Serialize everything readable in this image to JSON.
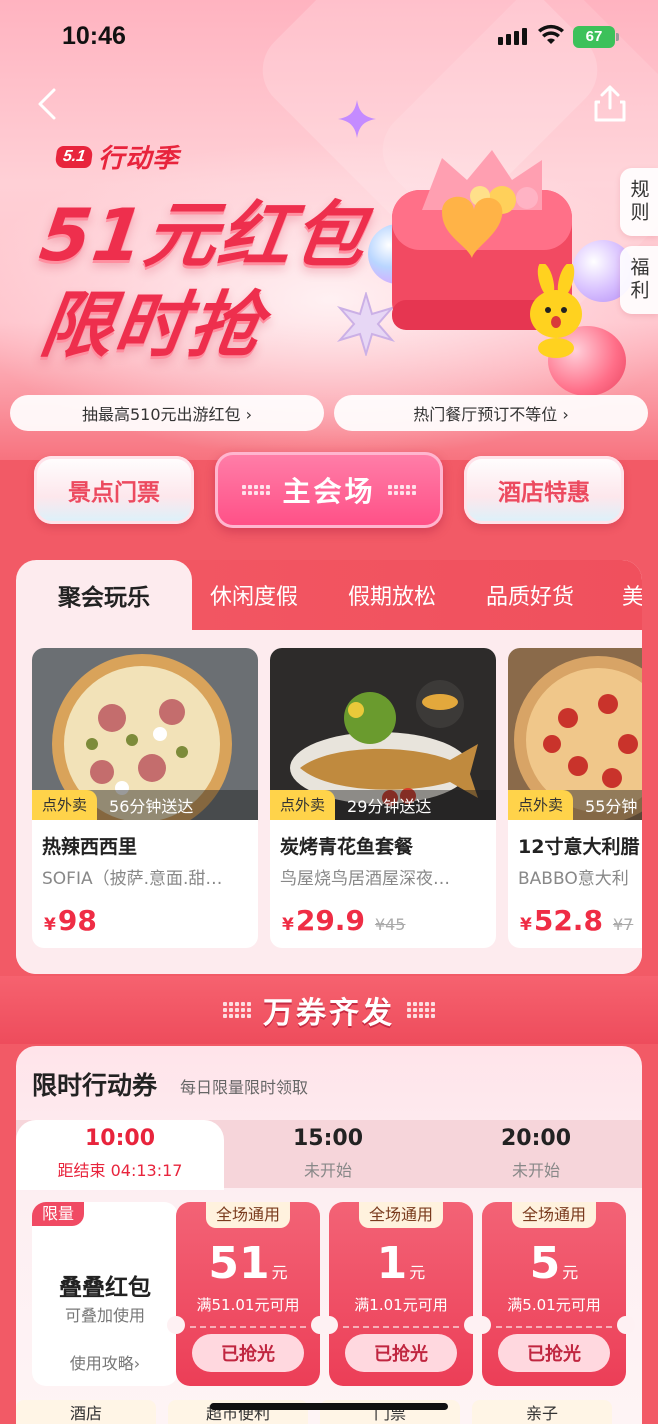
{
  "status_bar": {
    "time": "10:46",
    "battery": "67"
  },
  "hero": {
    "brand_badge": "5.1",
    "brand_text": "行动季",
    "headline_line1": "51元红包",
    "headline_line2": "限时抢",
    "side_tabs": [
      "规则",
      "福利"
    ],
    "info_pills": [
      "抽最高510元出游红包 ›",
      "热门餐厅预订不等位 ›"
    ]
  },
  "nav": {
    "left": "景点门票",
    "main": "主会场",
    "right": "酒店特惠"
  },
  "category_tabs": [
    "聚会玩乐",
    "休闲度假",
    "假期放松",
    "品质好货",
    "美"
  ],
  "products": [
    {
      "tag": "点外卖",
      "time": "56分钟送达",
      "title": "热辣西西里",
      "subtitle": "SOFIA（披萨.意面.甜…",
      "yen": "¥",
      "price": "98",
      "original": ""
    },
    {
      "tag": "点外卖",
      "time": "29分钟送达",
      "title": "炭烤青花鱼套餐",
      "subtitle": "鸟屋烧鸟居酒屋深夜…",
      "yen": "¥",
      "price": "29.9",
      "original": "¥45"
    },
    {
      "tag": "点外卖",
      "time": "55分钟",
      "title": "12寸意大利腊",
      "subtitle": "BABBO意大利",
      "yen": "¥",
      "price": "52.8",
      "original": "¥7"
    }
  ],
  "banner": {
    "title": "万券齐发"
  },
  "vouchers": {
    "title": "限时行动券",
    "subtitle": "每日限量限时领取",
    "slots": [
      {
        "time": "10:00",
        "status": "距结束 04:13:17",
        "active": true
      },
      {
        "time": "15:00",
        "status": "未开始",
        "active": false
      },
      {
        "time": "20:00",
        "status": "未开始",
        "active": false
      }
    ],
    "stack": {
      "tag": "限量",
      "title": "叠叠红包",
      "subtitle": "可叠加使用",
      "link": "使用攻略›"
    },
    "coupons": [
      {
        "tag": "全场通用",
        "amount": "51",
        "unit": "元",
        "condition": "满51.01元可用",
        "button": "已抢光"
      },
      {
        "tag": "全场通用",
        "amount": "1",
        "unit": "元",
        "condition": "满1.01元可用",
        "button": "已抢光"
      },
      {
        "tag": "全场通用",
        "amount": "5",
        "unit": "元",
        "condition": "满5.01元可用",
        "button": "已抢光"
      }
    ]
  },
  "bottom_categories": [
    "酒店",
    "超市便利",
    "门票",
    "亲子"
  ],
  "colors": {
    "accent": "#ee2f4d",
    "page_bg": "#f25a66",
    "main_button": "#ff4f86"
  }
}
